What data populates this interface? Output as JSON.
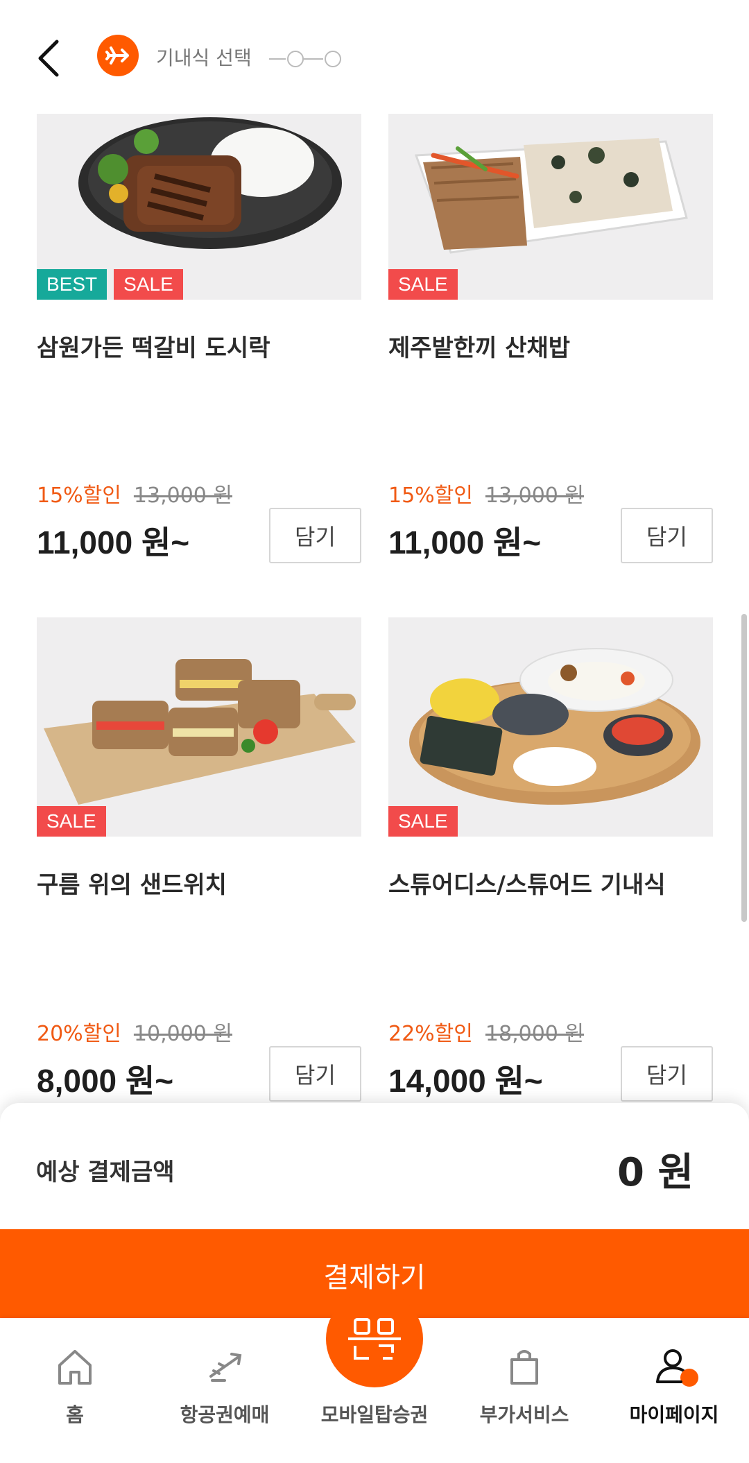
{
  "header": {
    "step_label": "기내식 선택"
  },
  "products": [
    {
      "name": "삼원가든 떡갈비 도시락",
      "badges": [
        "BEST",
        "SALE"
      ],
      "discount": "15%할인",
      "original_price": "13,000 원",
      "sale_price": "11,000 원~",
      "add_label": "담기",
      "image": "tteokgalbi-lunchbox"
    },
    {
      "name": "제주밭한끼 산채밥",
      "badges": [
        "SALE"
      ],
      "discount": "15%할인",
      "original_price": "13,000 원",
      "sale_price": "11,000 원~",
      "add_label": "담기",
      "image": "wild-vegetable-rice"
    },
    {
      "name": "구름 위의 샌드위치",
      "badges": [
        "SALE"
      ],
      "discount": "20%할인",
      "original_price": "10,000 원",
      "sale_price": "8,000 원~",
      "add_label": "담기",
      "image": "sandwich-board"
    },
    {
      "name": "스튜어디스/스튜어드 기내식",
      "badges": [
        "SALE"
      ],
      "discount": "22%할인",
      "original_price": "18,000 원",
      "sale_price": "14,000 원~",
      "add_label": "담기",
      "image": "korean-meal-tray"
    }
  ],
  "summary": {
    "label": "예상 결제금액",
    "amount": "0 원"
  },
  "pay_button": "결제하기",
  "nav": {
    "items": [
      {
        "label": "홈",
        "icon": "home-icon"
      },
      {
        "label": "항공권예매",
        "icon": "plane-ticket-icon"
      },
      {
        "label": "모바일탑승권",
        "icon": "qr-code-icon"
      },
      {
        "label": "부가서비스",
        "icon": "shopping-bag-icon"
      },
      {
        "label": "마이페이지",
        "icon": "user-icon",
        "active": true
      }
    ]
  },
  "colors": {
    "brand": "#ff5a00",
    "best_badge": "#16a99a",
    "sale_badge": "#f24b4b",
    "discount_text": "#f05a14"
  }
}
